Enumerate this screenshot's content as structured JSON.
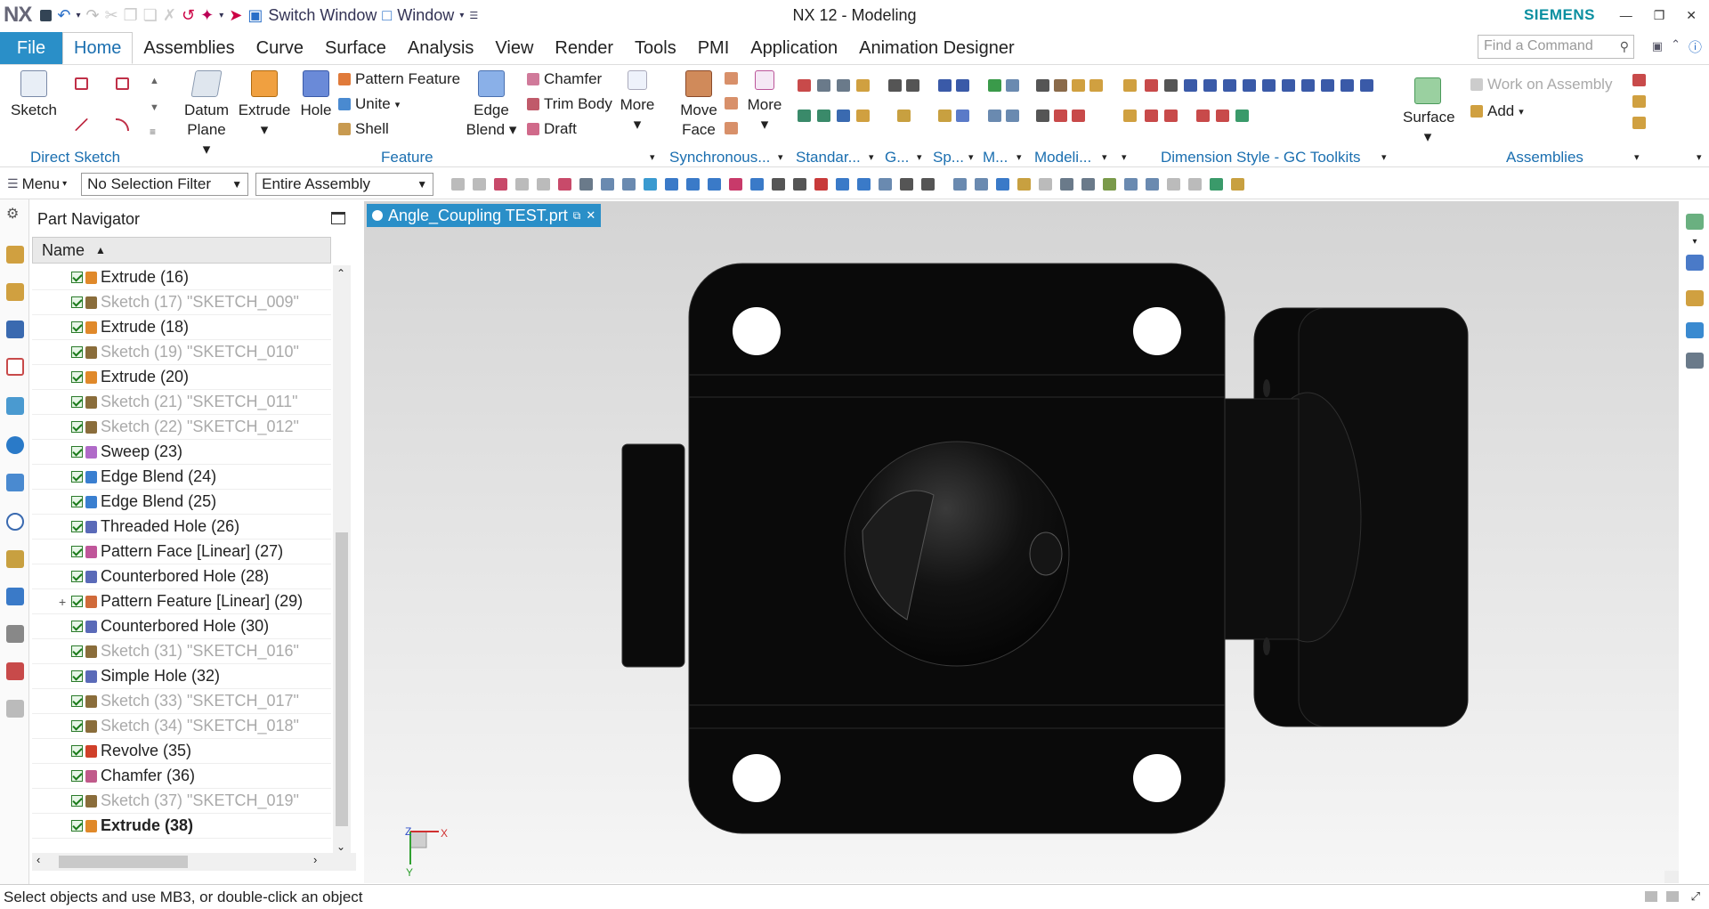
{
  "app": {
    "logo": "NX",
    "title": "NX 12 - Modeling",
    "brand": "SIEMENS"
  },
  "quick_access": {
    "switch_window": "Switch Window",
    "window": "Window"
  },
  "menu": {
    "file": "File",
    "tabs": [
      "Home",
      "Assemblies",
      "Curve",
      "Surface",
      "Analysis",
      "View",
      "Render",
      "Tools",
      "PMI",
      "Application",
      "Animation Designer"
    ],
    "active_tab": "Home",
    "find_placeholder": "Find a Command"
  },
  "ribbon": {
    "direct_sketch": {
      "label": "Direct Sketch",
      "sketch": "Sketch"
    },
    "feature": {
      "label": "Feature",
      "datum_plane_1": "Datum",
      "datum_plane_2": "Plane",
      "extrude": "Extrude",
      "hole": "Hole",
      "pattern_feature": "Pattern Feature",
      "unite": "Unite",
      "shell": "Shell",
      "edge_blend_1": "Edge",
      "edge_blend_2": "Blend",
      "chamfer": "Chamfer",
      "trim_body": "Trim Body",
      "draft": "Draft",
      "more": "More"
    },
    "synchronous": {
      "label": "Synchronous...",
      "move_face_1": "Move",
      "move_face_2": "Face",
      "more": "More"
    },
    "standard": {
      "label": "Standar..."
    },
    "g": {
      "label": "G..."
    },
    "sp": {
      "label": "Sp..."
    },
    "m": {
      "label": "M..."
    },
    "modeli": {
      "label": "Modeli..."
    },
    "dimension_style": {
      "label": "Dimension Style - GC Toolkits"
    },
    "surface": {
      "label": "Surface"
    },
    "assemblies": {
      "label": "Assemblies",
      "work_on_assembly": "Work on Assembly",
      "add": "Add"
    }
  },
  "toolbar": {
    "menu": "Menu",
    "selection_filter": "No Selection Filter",
    "scope": "Entire Assembly"
  },
  "navigator": {
    "title": "Part Navigator",
    "column": "Name",
    "rows": [
      {
        "label": "Extrude (16)",
        "style": "normal",
        "icon": "extrude-icon",
        "color": "#e0892a"
      },
      {
        "label": "Sketch (17) \"SKETCH_009\"",
        "style": "dim",
        "icon": "sketch-icon",
        "color": "#8a6d3b"
      },
      {
        "label": "Extrude (18)",
        "style": "normal",
        "icon": "extrude-icon",
        "color": "#e0892a"
      },
      {
        "label": "Sketch (19) \"SKETCH_010\"",
        "style": "dim",
        "icon": "sketch-icon",
        "color": "#8a6d3b"
      },
      {
        "label": "Extrude (20)",
        "style": "normal",
        "icon": "extrude-icon",
        "color": "#e0892a"
      },
      {
        "label": "Sketch (21) \"SKETCH_011\"",
        "style": "dim",
        "icon": "sketch-icon",
        "color": "#8a6d3b"
      },
      {
        "label": "Sketch (22) \"SKETCH_012\"",
        "style": "dim",
        "icon": "sketch-icon",
        "color": "#8a6d3b"
      },
      {
        "label": "Sweep (23)",
        "style": "normal",
        "icon": "sweep-icon",
        "color": "#b06ac8"
      },
      {
        "label": "Edge Blend (24)",
        "style": "normal",
        "icon": "edge-blend-icon",
        "color": "#3a7fd0"
      },
      {
        "label": "Edge Blend (25)",
        "style": "normal",
        "icon": "edge-blend-icon",
        "color": "#3a7fd0"
      },
      {
        "label": "Threaded Hole (26)",
        "style": "normal",
        "icon": "threaded-hole-icon",
        "color": "#5a6ab8"
      },
      {
        "label": "Pattern Face [Linear] (27)",
        "style": "normal",
        "icon": "pattern-face-icon",
        "color": "#c0569a"
      },
      {
        "label": "Counterbored Hole (28)",
        "style": "normal",
        "icon": "counterbored-hole-icon",
        "color": "#5a6ab8"
      },
      {
        "label": "Pattern Feature [Linear] (29)",
        "style": "normal",
        "icon": "pattern-feature-icon",
        "color": "#d06a3a",
        "expand": "+"
      },
      {
        "label": "Counterbored Hole (30)",
        "style": "normal",
        "icon": "counterbored-hole-icon",
        "color": "#5a6ab8"
      },
      {
        "label": "Sketch (31) \"SKETCH_016\"",
        "style": "dim",
        "icon": "sketch-icon",
        "color": "#8a6d3b"
      },
      {
        "label": "Simple Hole (32)",
        "style": "normal",
        "icon": "simple-hole-icon",
        "color": "#5a6ab8"
      },
      {
        "label": "Sketch (33) \"SKETCH_017\"",
        "style": "dim",
        "icon": "sketch-icon",
        "color": "#8a6d3b"
      },
      {
        "label": "Sketch (34) \"SKETCH_018\"",
        "style": "dim",
        "icon": "sketch-icon",
        "color": "#8a6d3b"
      },
      {
        "label": "Revolve (35)",
        "style": "normal",
        "icon": "revolve-icon",
        "color": "#d0402a"
      },
      {
        "label": "Chamfer (36)",
        "style": "normal",
        "icon": "chamfer-icon",
        "color": "#c05a8a"
      },
      {
        "label": "Sketch (37) \"SKETCH_019\"",
        "style": "dim",
        "icon": "sketch-icon",
        "color": "#8a6d3b"
      },
      {
        "label": "Extrude (38)",
        "style": "bold",
        "icon": "extrude-icon",
        "color": "#e0892a"
      }
    ]
  },
  "viewport": {
    "tab_label": "Angle_Coupling TEST.prt",
    "axis_x": "X",
    "axis_y": "Y",
    "axis_z": "Z"
  },
  "status": {
    "text": "Select objects and use MB3, or double-click an object"
  },
  "colors": {
    "accent": "#2a8fc8",
    "brand": "#0a8fa0",
    "label_blue": "#1b6fb0"
  }
}
